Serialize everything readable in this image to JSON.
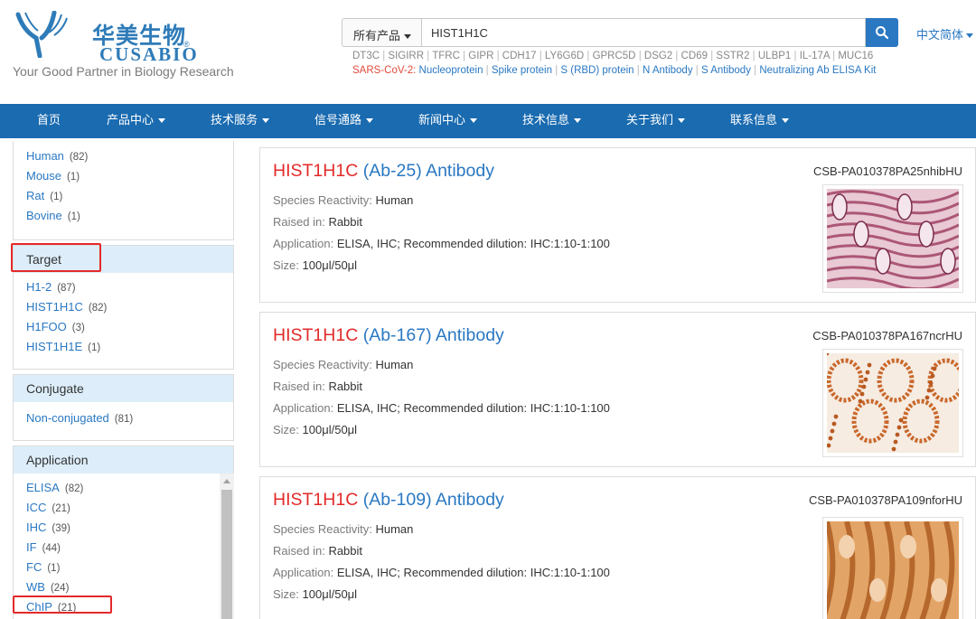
{
  "header": {
    "logo_cn": "华美生物",
    "logo_en": "CUSABIO",
    "logo_reg": "®",
    "tagline": "Your Good Partner in Biology Research",
    "search": {
      "category": "所有产品",
      "query": "HIST1H1C"
    },
    "language": "中文简体",
    "hot_keywords": [
      "DT3C",
      "SIGIRR",
      "TFRC",
      "GIPR",
      "CDH17",
      "LY6G6D",
      "GPRC5D",
      "DSG2",
      "CD69",
      "SSTR2",
      "ULBP1",
      "IL-17A",
      "MUC16"
    ],
    "sars_label": "SARS-CoV-2:",
    "sars_links": [
      "Nucleoprotein",
      "Spike protein",
      "S (RBD) protein",
      "N Antibody",
      "S Antibody",
      "Neutralizing Ab ELISA Kit"
    ],
    "colors": {
      "brand": "#2e7bb8",
      "accent": "#2a78c2",
      "sars": "#e14a3c"
    }
  },
  "nav": {
    "items": [
      "首页",
      "产品中心",
      "技术服务",
      "信号通路",
      "新闻中心",
      "技术信息",
      "关于我们",
      "联系信息"
    ],
    "background": "#1a6bb0"
  },
  "sidebar": {
    "species": [
      {
        "label": "Human",
        "count": "(82)"
      },
      {
        "label": "Mouse",
        "count": "(1)"
      },
      {
        "label": "Rat",
        "count": "(1)"
      },
      {
        "label": "Bovine",
        "count": "(1)"
      }
    ],
    "target": {
      "title": "Target",
      "items": [
        {
          "label": "H1-2",
          "count": "(87)"
        },
        {
          "label": "HIST1H1C",
          "count": "(82)"
        },
        {
          "label": "H1FOO",
          "count": "(3)"
        },
        {
          "label": "HIST1H1E",
          "count": "(1)"
        }
      ]
    },
    "conjugate": {
      "title": "Conjugate",
      "items": [
        {
          "label": "Non-conjugated",
          "count": "(81)"
        }
      ]
    },
    "application": {
      "title": "Application",
      "items": [
        {
          "label": "ELISA",
          "count": "(82)"
        },
        {
          "label": "ICC",
          "count": "(21)"
        },
        {
          "label": "IHC",
          "count": "(39)"
        },
        {
          "label": "IF",
          "count": "(44)"
        },
        {
          "label": "FC",
          "count": "(1)"
        },
        {
          "label": "WB",
          "count": "(24)"
        },
        {
          "label": "ChIP",
          "count": "(21)"
        }
      ]
    },
    "highlight_color": "#e32a2a"
  },
  "products": [
    {
      "gene": "HIST1H1C",
      "rest": " (Ab-25) Antibody",
      "code": "CSB-PA010378PA25nhibHU",
      "species_label": "Species Reactivity:",
      "species": "Human",
      "raised_label": "Raised in:",
      "raised": "Rabbit",
      "application_label": "Application:",
      "application": "ELISA, IHC; Recommended dilution: IHC:1:10-1:100",
      "size_label": "Size:",
      "size": "100μl/50μl",
      "image": "ihc-stain-purple"
    },
    {
      "gene": "HIST1H1C",
      "rest": " (Ab-167) Antibody",
      "code": "CSB-PA010378PA167ncrHU",
      "species_label": "Species Reactivity:",
      "species": "Human",
      "raised_label": "Raised in:",
      "raised": "Rabbit",
      "application_label": "Application:",
      "application": "ELISA, IHC; Recommended dilution: IHC:1:10-1:100",
      "size_label": "Size:",
      "size": "100μl/50μl",
      "image": "ihc-stain-light-brown"
    },
    {
      "gene": "HIST1H1C",
      "rest": " (Ab-109) Antibody",
      "code": "CSB-PA010378PA109nforHU",
      "species_label": "Species Reactivity:",
      "species": "Human",
      "raised_label": "Raised in:",
      "raised": "Rabbit",
      "application_label": "Application:",
      "application": "ELISA, IHC; Recommended dilution: IHC:1:10-1:100",
      "size_label": "Size:",
      "size": "100μl/50μl",
      "image": "ihc-stain-brown"
    }
  ]
}
